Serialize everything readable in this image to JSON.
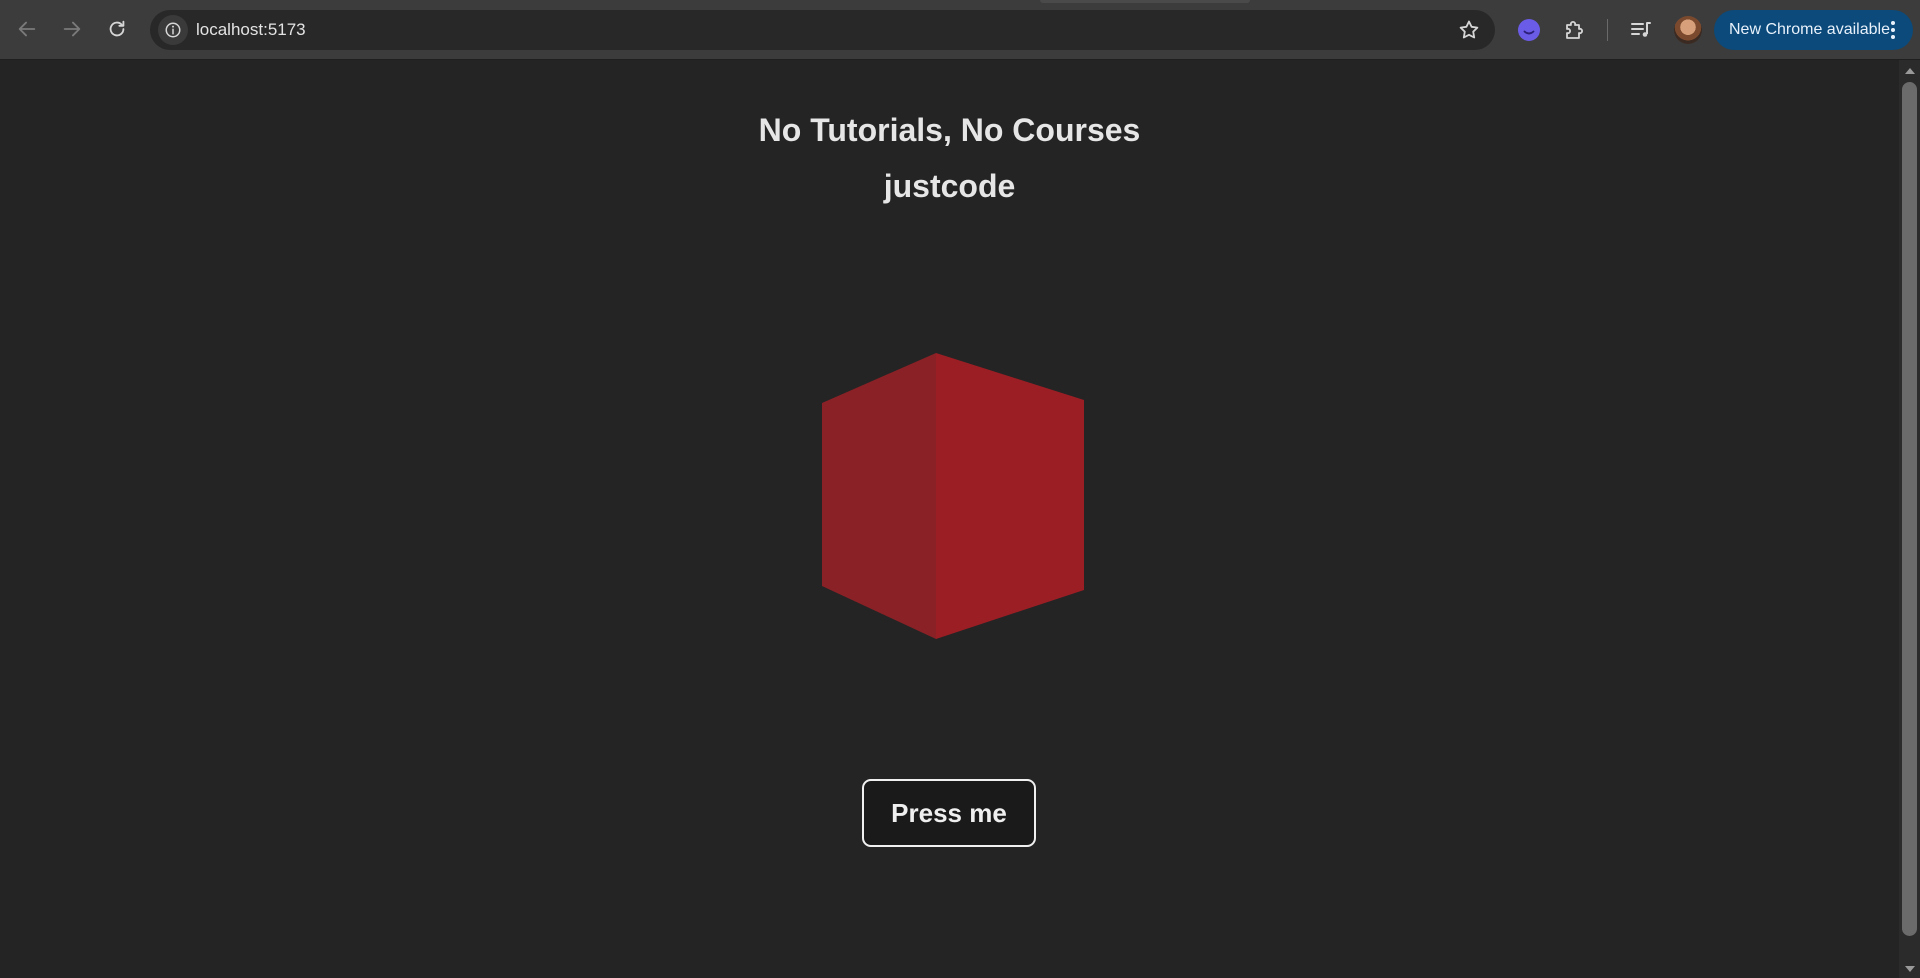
{
  "browser": {
    "url": "localhost:5173",
    "update_label": "New Chrome available",
    "icons": {
      "back": "arrow-left-icon",
      "forward": "arrow-right-icon",
      "reload": "reload-icon",
      "site_info": "info-icon",
      "bookmark": "star-icon",
      "extension_face": "smiley-extension-icon",
      "extensions": "puzzle-icon",
      "media": "media-playlist-icon",
      "menu": "kebab-icon"
    }
  },
  "page": {
    "headline": "No Tutorials, No Courses",
    "subline": "justcode",
    "button_label": "Press me",
    "colors": {
      "background": "#242424",
      "cube_left_face": "#8a2126",
      "cube_right_face": "#9b1e25",
      "button_border": "#f0f0f0"
    }
  }
}
